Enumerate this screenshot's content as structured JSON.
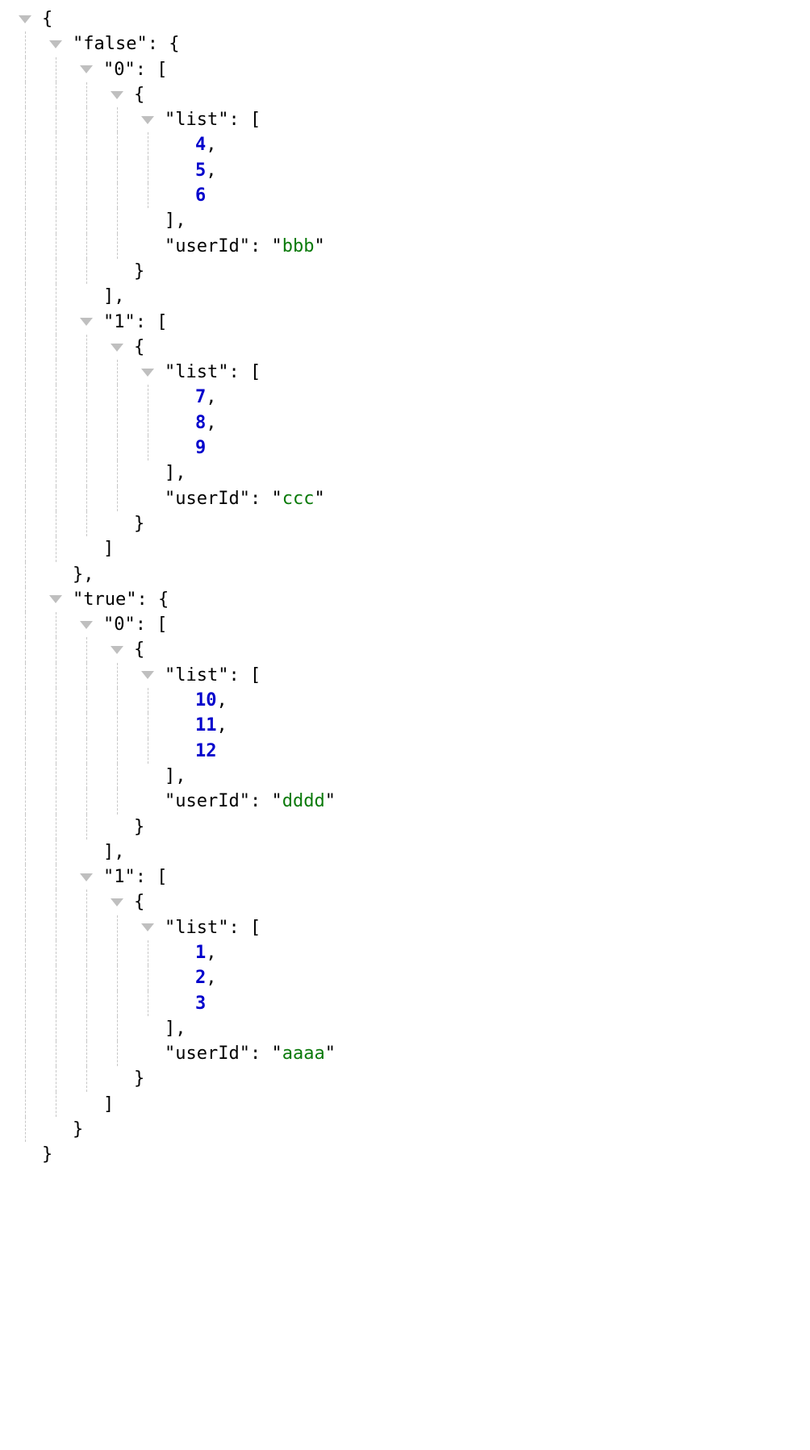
{
  "punct": {
    "obrace": "{",
    "cbrace": "}",
    "cbrace_comma": "},",
    "obracket": "[",
    "cbracket": "]",
    "cbracket_comma": "],",
    "colon_sp": ": ",
    "comma": ",",
    "q": "\""
  },
  "keys": {
    "false": "false",
    "true": "true",
    "zero": "0",
    "one": "1",
    "list": "list",
    "userId": "userId"
  },
  "values": {
    "bbb": "bbb",
    "ccc": "ccc",
    "dddd": "dddd",
    "aaaa": "aaaa",
    "n1": "1",
    "n2": "2",
    "n3": "3",
    "n4": "4",
    "n5": "5",
    "n6": "6",
    "n7": "7",
    "n8": "8",
    "n9": "9",
    "n10": "10",
    "n11": "11",
    "n12": "12"
  },
  "json_tree": {
    "false": {
      "0": [
        {
          "list": [
            4,
            5,
            6
          ],
          "userId": "bbb"
        }
      ],
      "1": [
        {
          "list": [
            7,
            8,
            9
          ],
          "userId": "ccc"
        }
      ]
    },
    "true": {
      "0": [
        {
          "list": [
            10,
            11,
            12
          ],
          "userId": "dddd"
        }
      ],
      "1": [
        {
          "list": [
            1,
            2,
            3
          ],
          "userId": "aaaa"
        }
      ]
    }
  }
}
